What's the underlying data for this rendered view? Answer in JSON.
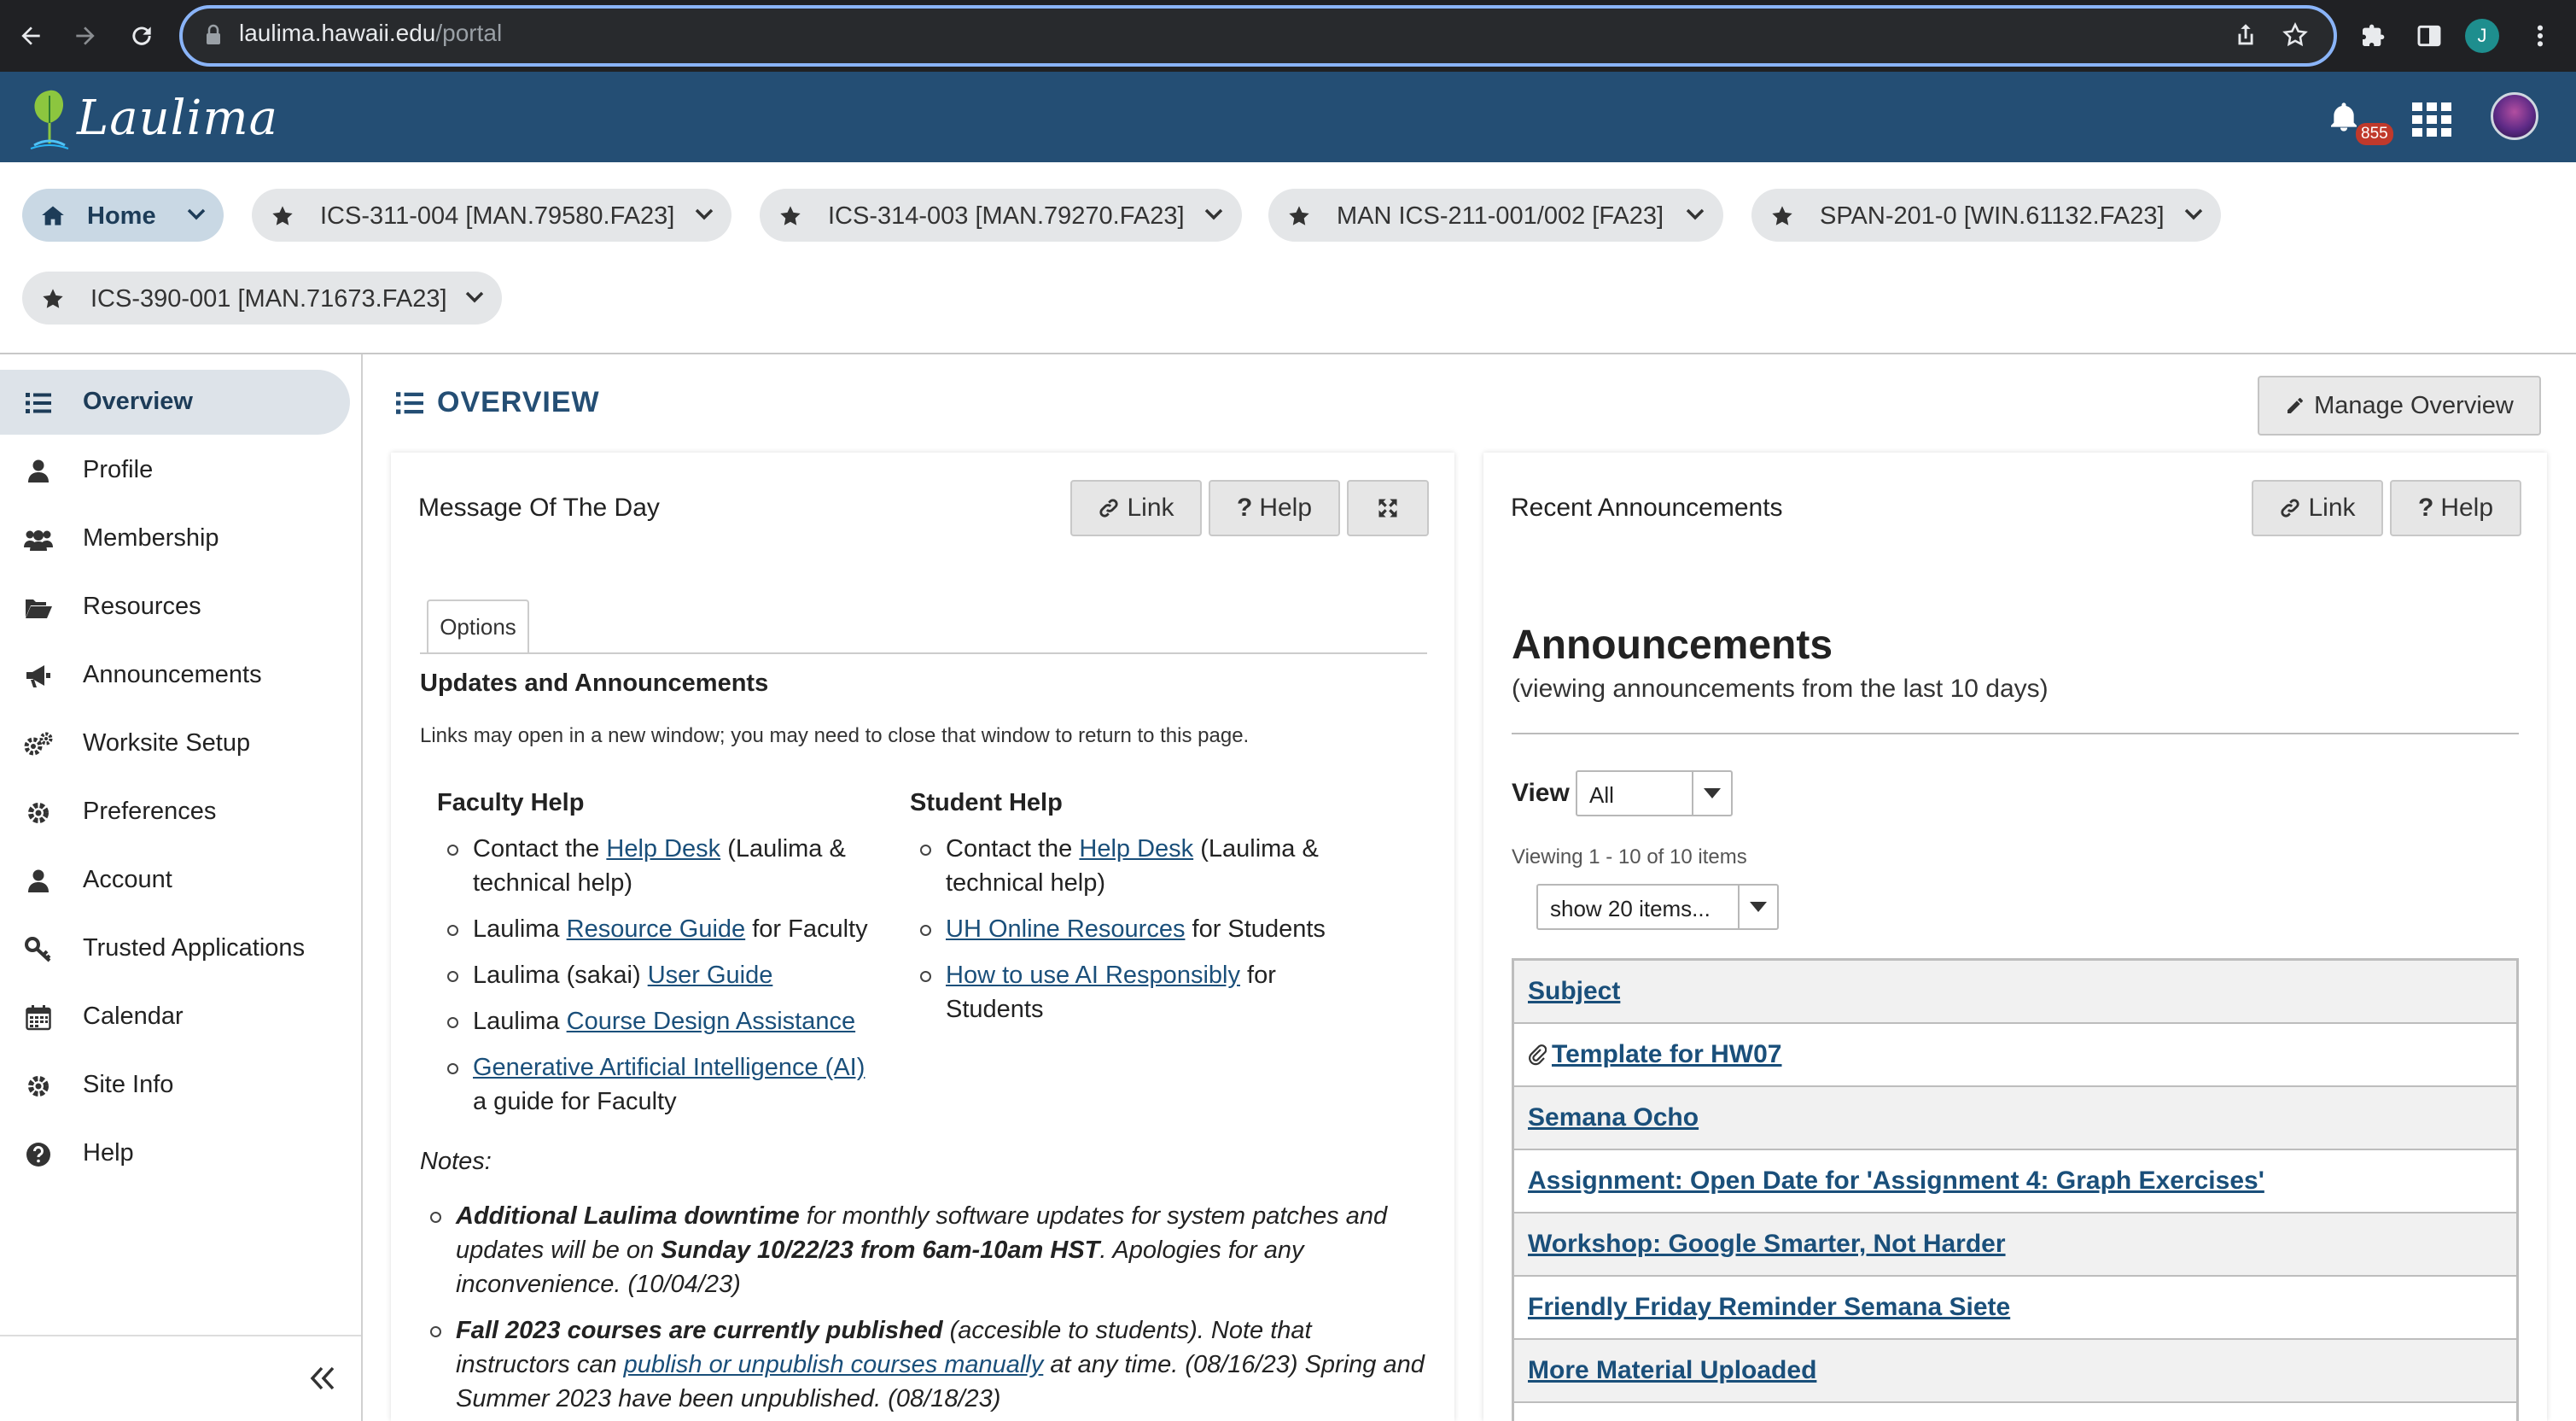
{
  "browser": {
    "url_host": "laulima.hawaii.edu",
    "url_path": "/portal",
    "profile_initial": "J"
  },
  "header": {
    "logo_text": "Laulima",
    "notification_count": "855"
  },
  "sites": [
    {
      "label": "Home",
      "icon": "home-icon"
    },
    {
      "label": "ICS-311-004 [MAN.79580.FA23]",
      "icon": "star-icon"
    },
    {
      "label": "ICS-314-003 [MAN.79270.FA23]",
      "icon": "star-icon"
    },
    {
      "label": "MAN ICS-211-001/002 [FA23]",
      "icon": "star-icon"
    },
    {
      "label": "SPAN-201-0 [WIN.61132.FA23]",
      "icon": "star-icon"
    },
    {
      "label": "ICS-390-001 [MAN.71673.FA23]",
      "icon": "star-icon"
    }
  ],
  "tools": [
    {
      "label": "Overview",
      "icon": "list-icon"
    },
    {
      "label": "Profile",
      "icon": "user-icon"
    },
    {
      "label": "Membership",
      "icon": "users-icon"
    },
    {
      "label": "Resources",
      "icon": "folder-open-icon"
    },
    {
      "label": "Announcements",
      "icon": "bullhorn-icon"
    },
    {
      "label": "Worksite Setup",
      "icon": "cogs-icon"
    },
    {
      "label": "Preferences",
      "icon": "gear-icon"
    },
    {
      "label": "Account",
      "icon": "user-icon"
    },
    {
      "label": "Trusted Applications",
      "icon": "key-icon"
    },
    {
      "label": "Calendar",
      "icon": "calendar-icon"
    },
    {
      "label": "Site Info",
      "icon": "gear-icon"
    },
    {
      "label": "Help",
      "icon": "question-circle-icon"
    }
  ],
  "main": {
    "title": "OVERVIEW",
    "manage_label": "Manage Overview"
  },
  "motd": {
    "title": "Message Of The Day",
    "link_label": "Link",
    "help_label": "Help",
    "options_tab": "Options",
    "heading": "Updates and Announcements",
    "subtitle": "Links may open in a new window; you may need to close that window to return to this page.",
    "faculty": {
      "heading": "Faculty Help",
      "i1_pre": "Contact the ",
      "i1_link": "Help Desk",
      "i1_post": " (Laulima & technical help)",
      "i2_pre": "Laulima ",
      "i2_link": "Resource Guide",
      "i2_post": " for Faculty",
      "i3_pre": "Laulima (sakai) ",
      "i3_link": "User Guide",
      "i4_pre": "Laulima ",
      "i4_link": "Course Design Assistance",
      "i5_link": "Generative Artificial Intelligence (AI)",
      "i5_post": "  a guide for Faculty"
    },
    "student": {
      "heading": "Student Help",
      "i1_pre": "Contact the ",
      "i1_link": "Help Desk",
      "i1_post": " (Laulima & technical help)",
      "i2_link": "UH Online Resources",
      "i2_post": " for Students",
      "i3_link": "How to use AI Responsibly",
      "i3_post": " for Students"
    },
    "notes_label": "Notes:",
    "note1": {
      "b1": "Additional Laulima downtime",
      "t1": " for monthly software updates for system patches and updates will be on ",
      "b2": "Sunday 10/22/23 from 6am-10am HST",
      "t2": ". Apologies for any inconvenience. (10/04/23)"
    },
    "note2": {
      "b1": "Fall 2023 courses are currently published",
      "t1": " (accesible to students). Note that instructors can ",
      "link": "publish or unpublish courses manually",
      "t2": " at any time. (08/16/23) Spring and Summer 2023 have been unpublished. (08/18/23)"
    }
  },
  "announcements": {
    "portlet_title": "Recent Announcements",
    "link_label": "Link",
    "help_label": "Help",
    "heading": "Announcements",
    "subheading": "(viewing announcements from the last 10 days)",
    "view_label": "View",
    "view_value": "All",
    "viewing_text": "Viewing 1 - 10 of 10 items",
    "page_size": "show 20 items...",
    "rows": [
      {
        "label": "Subject"
      },
      {
        "label": "Template for HW07",
        "attachment": true
      },
      {
        "label": "Semana Ocho"
      },
      {
        "label": "Assignment: Open Date for 'Assignment 4: Graph Exercises'"
      },
      {
        "label": "Workshop: Google Smarter, Not Harder"
      },
      {
        "label": "Friendly Friday Reminder Semana Siete"
      },
      {
        "label": "More Material Uploaded"
      }
    ]
  }
}
